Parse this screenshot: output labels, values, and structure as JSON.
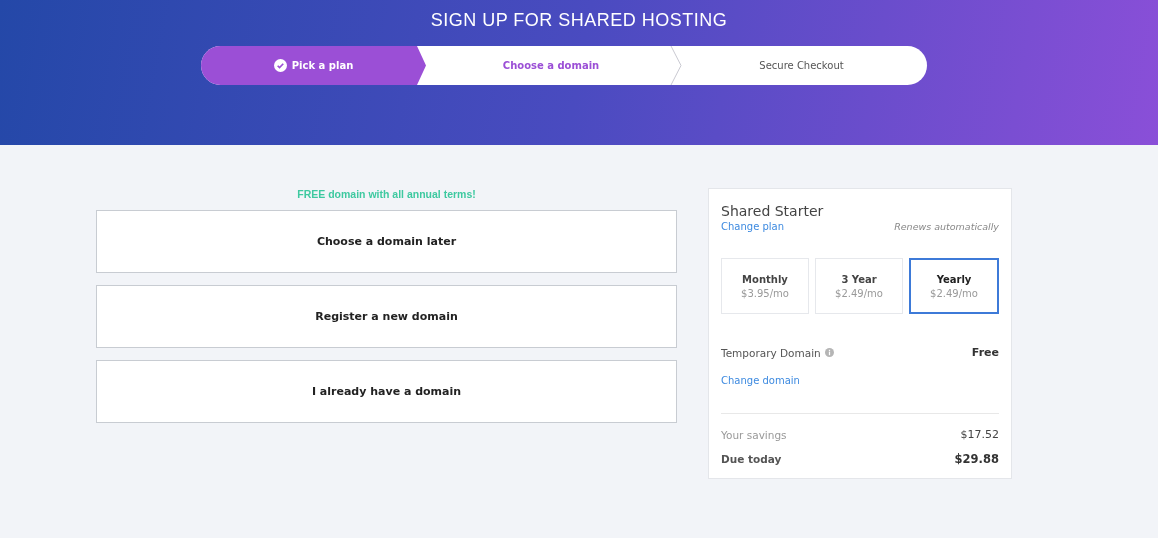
{
  "header": {
    "title": "SIGN UP FOR SHARED HOSTING"
  },
  "steps": [
    {
      "label": "Pick a plan",
      "kind": "done"
    },
    {
      "label": "Choose a domain",
      "kind": "current"
    },
    {
      "label": "Secure Checkout",
      "kind": "upcoming"
    }
  ],
  "promo": "FREE domain with all annual terms!",
  "domain_options": [
    "Choose a domain later",
    "Register a new domain",
    "I already have a domain"
  ],
  "summary": {
    "plan": "Shared Starter",
    "change_plan": "Change plan",
    "renews": "Renews automatically",
    "terms": [
      {
        "name": "Monthly",
        "price": "$3.95/mo",
        "selected": false
      },
      {
        "name": "3 Year",
        "price": "$2.49/mo",
        "selected": false
      },
      {
        "name": "Yearly",
        "price": "$2.49/mo",
        "selected": true
      }
    ],
    "domain_label": "Temporary Domain",
    "domain_price": "Free",
    "change_domain": "Change domain",
    "savings_label": "Your savings",
    "savings": "$17.52",
    "due_label": "Due today",
    "due": "$29.88"
  }
}
